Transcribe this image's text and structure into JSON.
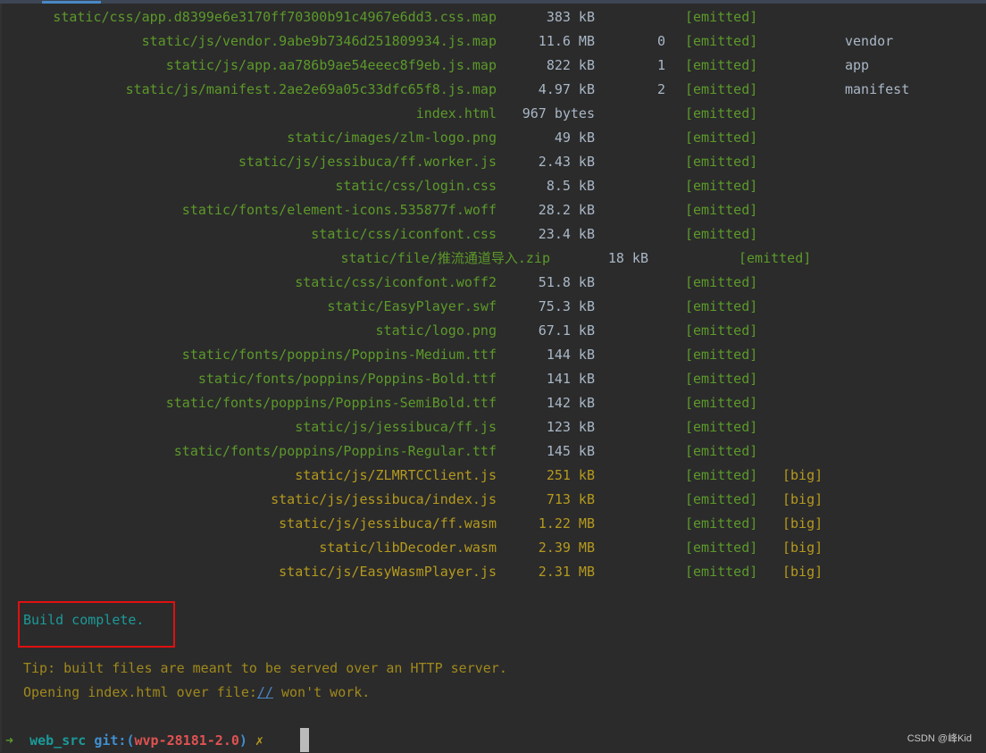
{
  "terminal": {
    "assets": [
      {
        "asset": "static/css/app.d8399e6e3170ff70300b91c4967e6dd3.css.map",
        "size": "383 kB",
        "chunk": "",
        "status": "[emitted]",
        "flag": "",
        "chunk_name": ""
      },
      {
        "asset": "static/js/vendor.9abe9b7346d251809934.js.map",
        "size": "11.6 MB",
        "chunk": "0",
        "status": "[emitted]",
        "flag": "",
        "chunk_name": "vendor"
      },
      {
        "asset": "static/js/app.aa786b9ae54eeec8f9eb.js.map",
        "size": "822 kB",
        "chunk": "1",
        "status": "[emitted]",
        "flag": "",
        "chunk_name": "app"
      },
      {
        "asset": "static/js/manifest.2ae2e69a05c33dfc65f8.js.map",
        "size": "4.97 kB",
        "chunk": "2",
        "status": "[emitted]",
        "flag": "",
        "chunk_name": "manifest"
      },
      {
        "asset": "index.html",
        "size": "967 bytes",
        "chunk": "",
        "status": "[emitted]",
        "flag": "",
        "chunk_name": ""
      },
      {
        "asset": "static/images/zlm-logo.png",
        "size": "49 kB",
        "chunk": "",
        "status": "[emitted]",
        "flag": "",
        "chunk_name": ""
      },
      {
        "asset": "static/js/jessibuca/ff.worker.js",
        "size": "2.43 kB",
        "chunk": "",
        "status": "[emitted]",
        "flag": "",
        "chunk_name": ""
      },
      {
        "asset": "static/css/login.css",
        "size": "8.5 kB",
        "chunk": "",
        "status": "[emitted]",
        "flag": "",
        "chunk_name": ""
      },
      {
        "asset": "static/fonts/element-icons.535877f.woff",
        "size": "28.2 kB",
        "chunk": "",
        "status": "[emitted]",
        "flag": "",
        "chunk_name": ""
      },
      {
        "asset": "static/css/iconfont.css",
        "size": "23.4 kB",
        "chunk": "",
        "status": "[emitted]",
        "flag": "",
        "chunk_name": ""
      },
      {
        "asset": "static/file/推流通道导入.zip",
        "size": "18 kB",
        "chunk": "",
        "status": "[emitted]",
        "flag": "",
        "chunk_name": ""
      },
      {
        "asset": "static/css/iconfont.woff2",
        "size": "51.8 kB",
        "chunk": "",
        "status": "[emitted]",
        "flag": "",
        "chunk_name": ""
      },
      {
        "asset": "static/EasyPlayer.swf",
        "size": "75.3 kB",
        "chunk": "",
        "status": "[emitted]",
        "flag": "",
        "chunk_name": ""
      },
      {
        "asset": "static/logo.png",
        "size": "67.1 kB",
        "chunk": "",
        "status": "[emitted]",
        "flag": "",
        "chunk_name": ""
      },
      {
        "asset": "static/fonts/poppins/Poppins-Medium.ttf",
        "size": "144 kB",
        "chunk": "",
        "status": "[emitted]",
        "flag": "",
        "chunk_name": ""
      },
      {
        "asset": "static/fonts/poppins/Poppins-Bold.ttf",
        "size": "141 kB",
        "chunk": "",
        "status": "[emitted]",
        "flag": "",
        "chunk_name": ""
      },
      {
        "asset": "static/fonts/poppins/Poppins-SemiBold.ttf",
        "size": "142 kB",
        "chunk": "",
        "status": "[emitted]",
        "flag": "",
        "chunk_name": ""
      },
      {
        "asset": "static/js/jessibuca/ff.js",
        "size": "123 kB",
        "chunk": "",
        "status": "[emitted]",
        "flag": "",
        "chunk_name": ""
      },
      {
        "asset": "static/fonts/poppins/Poppins-Regular.ttf",
        "size": "145 kB",
        "chunk": "",
        "status": "[emitted]",
        "flag": "",
        "chunk_name": ""
      },
      {
        "asset": "static/js/ZLMRTCClient.js",
        "size": "251 kB",
        "chunk": "",
        "status": "[emitted]",
        "flag": "[big]",
        "chunk_name": ""
      },
      {
        "asset": "static/js/jessibuca/index.js",
        "size": "713 kB",
        "chunk": "",
        "status": "[emitted]",
        "flag": "[big]",
        "chunk_name": ""
      },
      {
        "asset": "static/js/jessibuca/ff.wasm",
        "size": "1.22 MB",
        "chunk": "",
        "status": "[emitted]",
        "flag": "[big]",
        "chunk_name": ""
      },
      {
        "asset": "static/libDecoder.wasm",
        "size": "2.39 MB",
        "chunk": "",
        "status": "[emitted]",
        "flag": "[big]",
        "chunk_name": ""
      },
      {
        "asset": "static/js/EasyWasmPlayer.js",
        "size": "2.31 MB",
        "chunk": "",
        "status": "[emitted]",
        "flag": "[big]",
        "chunk_name": ""
      }
    ],
    "build_complete": "Build complete.",
    "tip_line1": "Tip: built files are meant to be served over an HTTP server.",
    "tip_line2_prefix": "Opening index.html over file:",
    "tip_line2_link": "//",
    "tip_line2_suffix": " won't work.",
    "prompt": {
      "arrow": "➜",
      "dir": "web_src",
      "git_label": "git:(",
      "branch": "wvp-28181-2.0",
      "git_close": ")",
      "dirty_mark": "✗"
    }
  },
  "watermark": "CSDN @峰Kid",
  "colors": {
    "background": "#2b2b2b",
    "asset_green": "#5c9a2a",
    "big_yellow": "#b59a1e",
    "cyan": "#1c9a9a",
    "branch_red": "#e05252",
    "highlight_red": "#e01010"
  }
}
